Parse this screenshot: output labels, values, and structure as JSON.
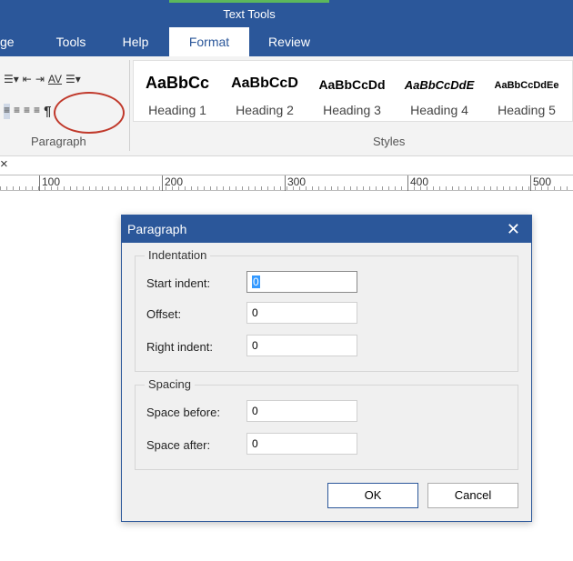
{
  "ribbon": {
    "context_tab_label": "Text Tools",
    "tabs": [
      {
        "label": "ge"
      },
      {
        "label": "Tools"
      },
      {
        "label": "Help"
      },
      {
        "label": "Format"
      },
      {
        "label": "Review"
      }
    ],
    "paragraph_group_label": "Paragraph",
    "styles_group_label": "Styles",
    "styles": [
      {
        "sample": "AaBbCc",
        "name": "Heading 1"
      },
      {
        "sample": "AaBbCcD",
        "name": "Heading 2"
      },
      {
        "sample": "AaBbCcDd",
        "name": "Heading 3"
      },
      {
        "sample": "AaBbCcDdE",
        "name": "Heading 4"
      },
      {
        "sample": "AaBbCcDdEe",
        "name": "Heading 5"
      }
    ]
  },
  "ruler": {
    "close_glyph": "×",
    "marks": [
      "100",
      "200",
      "300",
      "400",
      "500"
    ]
  },
  "dialog": {
    "title": "Paragraph",
    "close_glyph": "✕",
    "indentation": {
      "legend": "Indentation",
      "start_indent_label": "Start indent:",
      "start_indent_value": "0",
      "offset_label": "Offset:",
      "offset_value": "0",
      "right_indent_label": "Right indent:",
      "right_indent_value": "0"
    },
    "spacing": {
      "legend": "Spacing",
      "space_before_label": "Space before:",
      "space_before_value": "0",
      "space_after_label": "Space after:",
      "space_after_value": "0"
    },
    "ok_label": "OK",
    "cancel_label": "Cancel"
  },
  "colors": {
    "ribbon_blue": "#2b579a",
    "context_accent": "#5cb85c",
    "highlight_ring": "#c0392b"
  }
}
